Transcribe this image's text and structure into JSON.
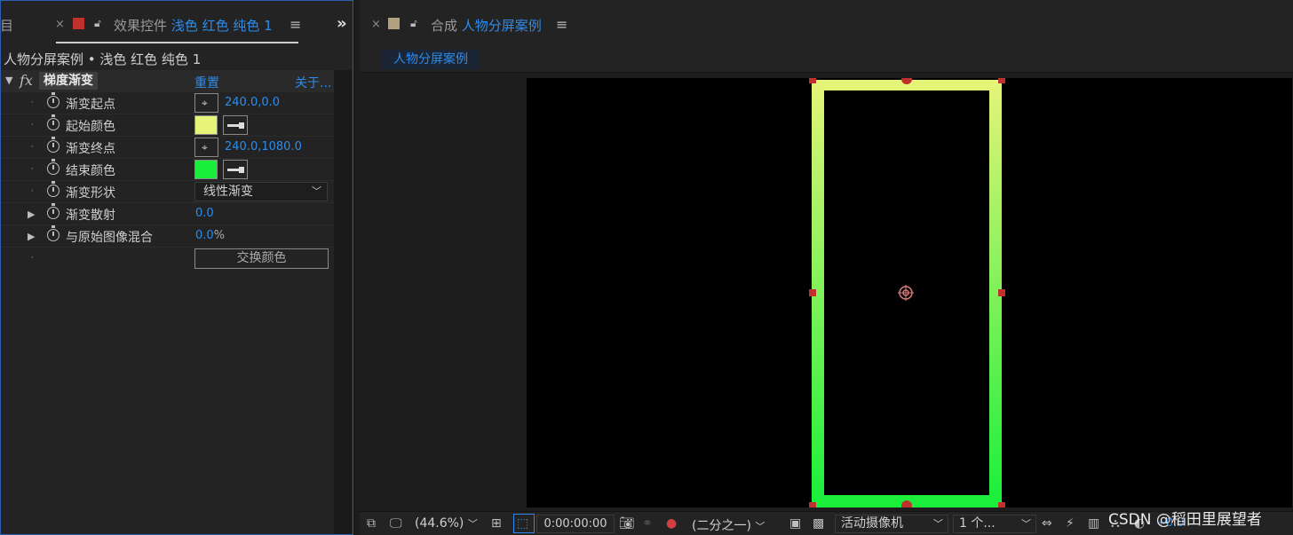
{
  "effects_panel": {
    "edge_label": "目",
    "tab": {
      "close": "×",
      "title_prefix": "效果控件",
      "title_layer": "浅色 红色 纯色 1",
      "menu": "≡",
      "swatch_color": "#c0312d"
    },
    "overflow": "»",
    "breadcrumb": "人物分屏案例 • 浅色 红色 纯色 1",
    "effect": {
      "fx": "fx",
      "name": "梯度渐变",
      "reset": "重置",
      "about": "关于..."
    },
    "properties": [
      {
        "label": "渐变起点",
        "value": "240.0,0.0"
      },
      {
        "label": "起始颜色",
        "color": "#e6f478"
      },
      {
        "label": "渐变终点",
        "value": "240.0,1080.0"
      },
      {
        "label": "结束颜色",
        "color": "#18ef3a"
      },
      {
        "label": "渐变形状",
        "select": "线性渐变"
      },
      {
        "label": "渐变散射",
        "value": "0.0"
      },
      {
        "label": "与原始图像混合",
        "value": "0.0",
        "unit": "%"
      }
    ],
    "swap_button": "交换颜色"
  },
  "comp_panel": {
    "tab": {
      "close": "×",
      "title_prefix": "合成",
      "title_comp": "人物分屏案例",
      "menu": "≡",
      "swatch_color": "#b3a07e"
    },
    "comp_chip": "人物分屏案例",
    "gradient": {
      "start": "#e6f478",
      "end": "#18ef3a"
    },
    "toolbar": {
      "zoom": "(44.6%)",
      "timecode": "0:00:00:00",
      "resolution": "(二分之一)",
      "camera": "活动摄像机",
      "views": "1 个...",
      "exposure": "+0.0"
    }
  },
  "watermark": "CSDN @稻田里展望者"
}
